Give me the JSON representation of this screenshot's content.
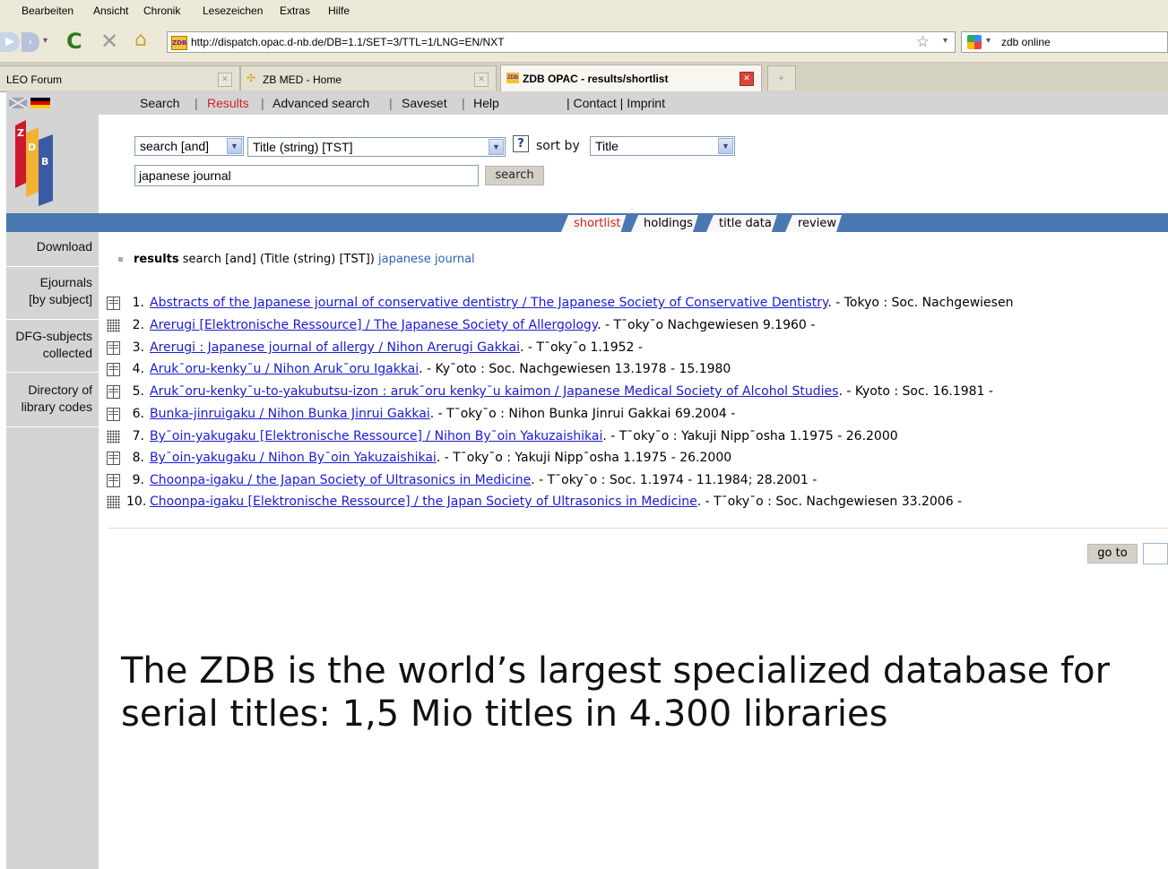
{
  "menu": [
    "Bearbeiten",
    "Ansicht",
    "Chronik",
    "Lesezeichen",
    "Extras",
    "Hilfe"
  ],
  "address": {
    "url": "http://dispatch.opac.d-nb.de/DB=1.1/SET=3/TTL=1/LNG=EN/NXT",
    "favicon": "ZDB"
  },
  "search_engine": {
    "text": "zdb online"
  },
  "tabs": [
    {
      "label": "LEO Forum"
    },
    {
      "label": "ZB MED - Home"
    },
    {
      "label": "ZDB OPAC - results/shortlist"
    },
    {
      "label": "+"
    }
  ],
  "page_nav": {
    "search": "Search",
    "results": "Results",
    "advanced": "Advanced search",
    "saveset": "Saveset",
    "help": "Help",
    "contact": "| Contact | Imprint"
  },
  "form": {
    "operator": "search [and]",
    "index": "Title (string) [TST]",
    "help_label": "?",
    "sort_label": "sort by",
    "sort_value": "Title",
    "query": "japanese journal",
    "search_button": "search"
  },
  "result_tabs": [
    "shortlist",
    "holdings",
    "title data",
    "review"
  ],
  "sidebar": {
    "download": "Download",
    "ejournals_1": "Ejournals",
    "ejournals_2": "[by subject]",
    "dfg_1": "DFG-subjects",
    "dfg_2": "collected",
    "dir_1": "Directory of",
    "dir_2": "library codes"
  },
  "results_header": {
    "label": "results",
    "query_desc": "search [and] (Title (string) [TST])",
    "query": "japanese journal"
  },
  "results": [
    {
      "num": "1.",
      "type": "print",
      "title": "Abstracts of the Japanese journal of conservative dentistry / The Japanese Society of Conservative Dentistry",
      "info": ". - Tokyo : Soc.   Nachgewiesen"
    },
    {
      "num": "2.",
      "type": "electronic",
      "title": "Arerugi [Elektronische Ressource] / The Japanese Society of Allergology",
      "info": ". - T¯oky¯o   Nachgewiesen 9.1960 -"
    },
    {
      "num": "3.",
      "type": "print",
      "title": "Arerugi : Japanese journal of allergy / Nihon Arerugi Gakkai",
      "info": ". - T¯oky¯o   1.1952 -"
    },
    {
      "num": "4.",
      "type": "print",
      "title": "Aruk¯oru-kenky¯u / Nihon Aruk¯oru Igakkai",
      "info": ". - Ky¯oto : Soc.   Nachgewiesen 13.1978 - 15.1980"
    },
    {
      "num": "5.",
      "type": "print",
      "title": "Aruk¯oru-kenky¯u-to-yakubutsu-izon : aruk¯oru kenky¯u kaimon / Japanese Medical Society of Alcohol Studies",
      "info": ". - Kyoto : Soc.   16.1981 -"
    },
    {
      "num": "6.",
      "type": "print",
      "title": "Bunka-jinruigaku / Nihon Bunka Jinrui Gakkai",
      "info": ". - T¯oky¯o : Nihon Bunka Jinrui Gakkai   69.2004 -"
    },
    {
      "num": "7.",
      "type": "electronic",
      "title": "By¯oin-yakugaku [Elektronische Ressource] / Nihon By¯oin Yakuzaishikai",
      "info": ". - T¯oky¯o : Yakuji Nipp¯osha   1.1975 - 26.2000"
    },
    {
      "num": "8.",
      "type": "print",
      "title": "By¯oin-yakugaku / Nihon By¯oin Yakuzaishikai",
      "info": ". - T¯oky¯o : Yakuji Nipp¯osha   1.1975 - 26.2000"
    },
    {
      "num": "9.",
      "type": "print",
      "title": "Choonpa-igaku / the Japan Society of Ultrasonics in Medicine",
      "info": ". - T¯oky¯o : Soc.   1.1974 - 11.1984; 28.2001 -"
    },
    {
      "num": "10.",
      "type": "electronic",
      "title": "Choonpa-igaku [Elektronische Ressource] / the Japan Society of Ultrasonics in Medicine",
      "info": ". - T¯oky¯o : Soc.   Nachgewiesen 33.2006 -"
    }
  ],
  "goto": {
    "label": "go to"
  },
  "caption": "The ZDB is the world’s largest specialized database for serial titles: 1,5 Mio titles in 4.300 libraries",
  "colors": {
    "band": "#4b77b1",
    "link": "#1a1ad6",
    "active_tab": "#d81e1e",
    "sidebar": "#d4d4d4"
  }
}
